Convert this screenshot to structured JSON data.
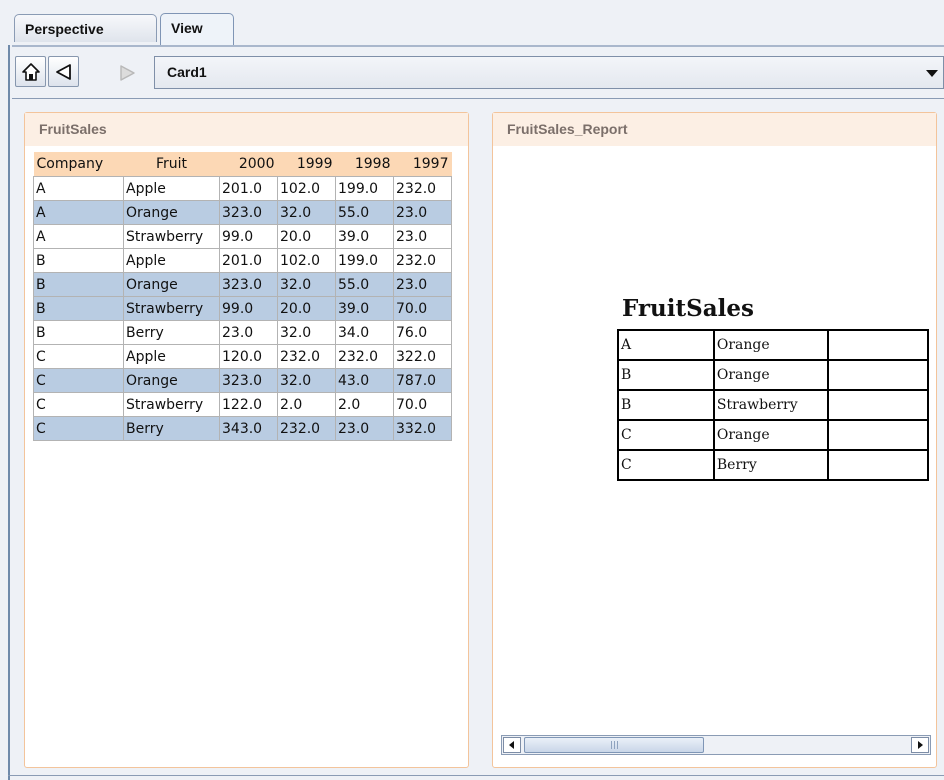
{
  "tabs": [
    {
      "label": "Perspective"
    },
    {
      "label": "View",
      "selected": true
    }
  ],
  "toolbar": {
    "home_icon": "home-icon",
    "back_icon": "back-arrow-icon",
    "forward_icon": "forward-arrow-icon",
    "card_select_value": "Card1"
  },
  "fruit_sales": {
    "title": "FruitSales",
    "columns": [
      "Company",
      "Fruit",
      "2000",
      "1999",
      "1998",
      "1997"
    ],
    "rows": [
      {
        "cells": [
          "A",
          "Apple",
          "201.0",
          "102.0",
          "199.0",
          "232.0"
        ],
        "selected": false
      },
      {
        "cells": [
          "A",
          "Orange",
          "323.0",
          "32.0",
          "55.0",
          "23.0"
        ],
        "selected": true
      },
      {
        "cells": [
          "A",
          "Strawberry",
          "99.0",
          "20.0",
          "39.0",
          "23.0"
        ],
        "selected": false
      },
      {
        "cells": [
          "B",
          "Apple",
          "201.0",
          "102.0",
          "199.0",
          "232.0"
        ],
        "selected": false
      },
      {
        "cells": [
          "B",
          "Orange",
          "323.0",
          "32.0",
          "55.0",
          "23.0"
        ],
        "selected": true
      },
      {
        "cells": [
          "B",
          "Strawberry",
          "99.0",
          "20.0",
          "39.0",
          "70.0"
        ],
        "selected": true
      },
      {
        "cells": [
          "B",
          "Berry",
          "23.0",
          "32.0",
          "34.0",
          "76.0"
        ],
        "selected": false
      },
      {
        "cells": [
          "C",
          "Apple",
          "120.0",
          "232.0",
          "232.0",
          "322.0"
        ],
        "selected": false
      },
      {
        "cells": [
          "C",
          "Orange",
          "323.0",
          "32.0",
          "43.0",
          "787.0"
        ],
        "selected": true
      },
      {
        "cells": [
          "C",
          "Strawberry",
          "122.0",
          "2.0",
          "2.0",
          "70.0"
        ],
        "selected": false
      },
      {
        "cells": [
          "C",
          "Berry",
          "343.0",
          "232.0",
          "23.0",
          "332.0"
        ],
        "selected": true
      }
    ]
  },
  "report": {
    "pane_title": "FruitSales_Report",
    "heading": "FruitSales",
    "rows": [
      [
        "A",
        "Orange",
        ""
      ],
      [
        "B",
        "Orange",
        ""
      ],
      [
        "B",
        "Strawberry",
        ""
      ],
      [
        "C",
        "Orange",
        ""
      ],
      [
        "C",
        "Berry",
        ""
      ]
    ]
  },
  "colors": {
    "selected_row": "#b9cce2",
    "header_bg": "#fcd8b5",
    "pane_border": "#f3c49b"
  }
}
